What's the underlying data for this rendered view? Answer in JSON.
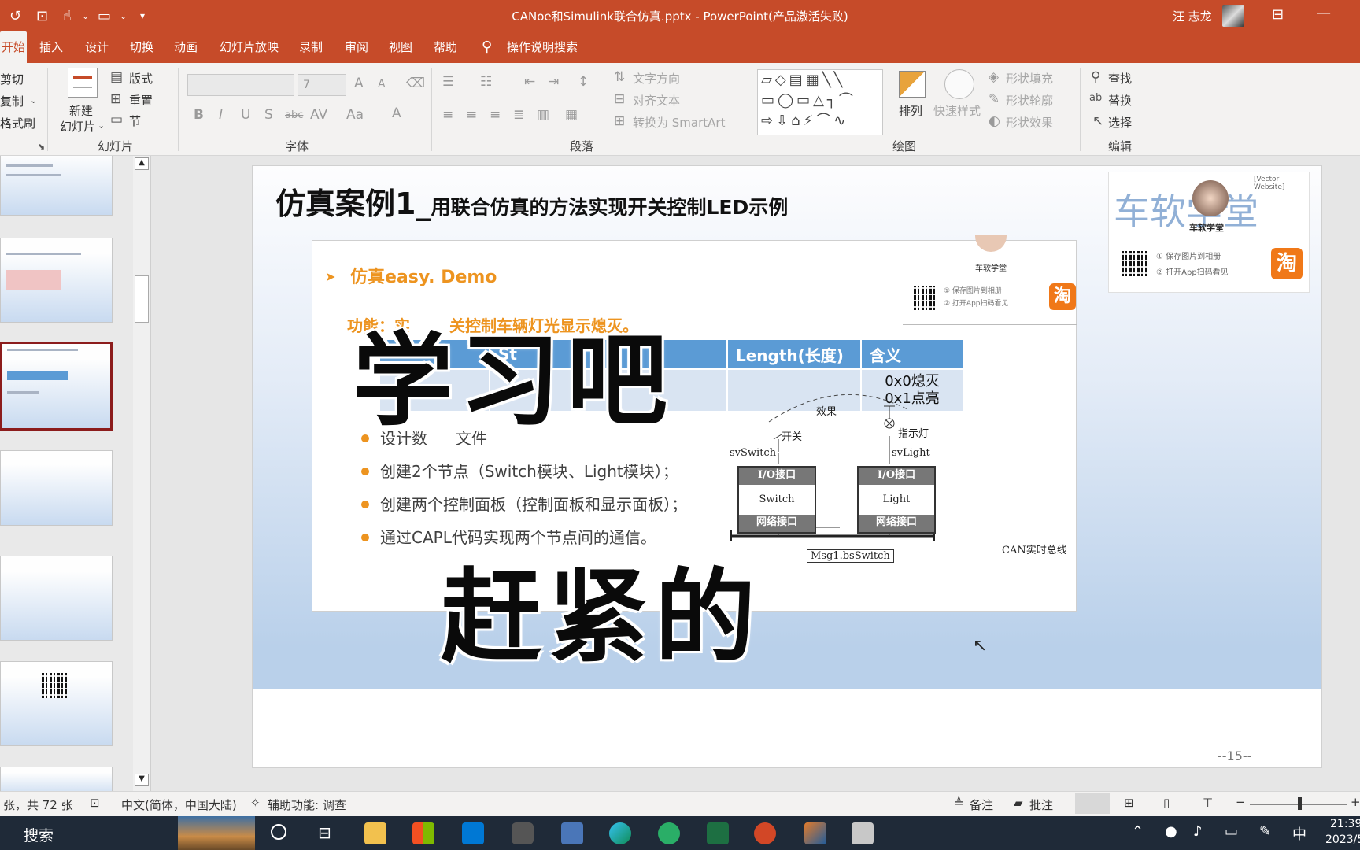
{
  "window": {
    "title": "CANoe和Simulink联合仿真.pptx  -  PowerPoint(产品激活失败)",
    "user": "汪 志龙"
  },
  "tabs": [
    "开始",
    "插入",
    "设计",
    "切换",
    "动画",
    "幻灯片放映",
    "录制",
    "审阅",
    "视图",
    "帮助"
  ],
  "tell_me": "操作说明搜索",
  "ribbon": {
    "clipboard": {
      "cut": "剪切",
      "copy": "复制",
      "format_painter": "格式刷"
    },
    "slides": {
      "new_slide_line1": "新建",
      "new_slide_line2": "幻灯片",
      "layout": "版式",
      "reset": "重置",
      "section": "节",
      "label": "幻灯片"
    },
    "font": {
      "size": "7",
      "label": "字体"
    },
    "paragraph": {
      "text_direction": "文字方向",
      "align_text": "对齐文本",
      "smartart": "转换为 SmartArt",
      "label": "段落"
    },
    "drawing": {
      "arrange": "排列",
      "quick_styles": "快速样式",
      "shape_fill": "形状填充",
      "shape_outline": "形状轮廓",
      "shape_effects": "形状效果",
      "label": "绘图"
    },
    "editing": {
      "find": "查找",
      "replace": "替换",
      "select": "选择",
      "label": "编辑"
    }
  },
  "slide": {
    "title": "仿真案例1",
    "title_sep": "_",
    "subtitle": "用联合仿真的方法实现开关控制LED示例",
    "page_number": "--15--",
    "watermark": {
      "text": "车软学堂",
      "avatar_caption": "车软学堂",
      "line1": "① 保存图片到相册",
      "line2": "② 打开App扫码看见",
      "site": "[Vector Website]",
      "tao": "淘"
    },
    "content": {
      "demo_title": "仿真easy. Demo",
      "function_text": "功能：实",
      "function_text_2": "关控制车辆灯光显示熄灭。",
      "watermark_caption": "车软学堂",
      "wm_line1": "① 保存图片到相册",
      "wm_line2": "② 打开App扫码看见",
      "table": {
        "headers": [
          "",
          "St",
          "始位)",
          "Length(长度)",
          "含义"
        ],
        "row": [
          "",
          "",
          "",
          "",
          "0x0熄灭\n0x1点亮"
        ]
      },
      "bullets": [
        "设计数",
        "文件",
        "创建2个节点（Switch模块、Light模块）；",
        "创建两个控制面板（控制面板和显示面板）；",
        "通过CAPL代码实现两个节点间的通信。"
      ],
      "diagram": {
        "effect": "效果",
        "switch_label": "开关",
        "indicator": "指示灯",
        "sv_switch": "svSwitch",
        "sv_light": "svLight",
        "io": "I/O接口",
        "net": "网络接口",
        "switch": "Switch",
        "light": "Light",
        "msg": "Msg1.bsSwitch",
        "bus": "CAN实时总线"
      }
    },
    "overlay_top": "学习吧",
    "overlay_bottom": "赶紧的"
  },
  "status": {
    "slide_count": "张，共 72 张",
    "language": "中文(简体，中国大陆)",
    "accessibility": "辅助功能: 调查",
    "notes": "备注",
    "comments": "批注"
  },
  "taskbar": {
    "search": "搜索",
    "ime": "中",
    "time": "21:39",
    "date": "2023/5"
  },
  "colors": {
    "accent": "#c64b29",
    "header_blue": "#5b9bd5",
    "bullet_orange": "#ed9420"
  }
}
